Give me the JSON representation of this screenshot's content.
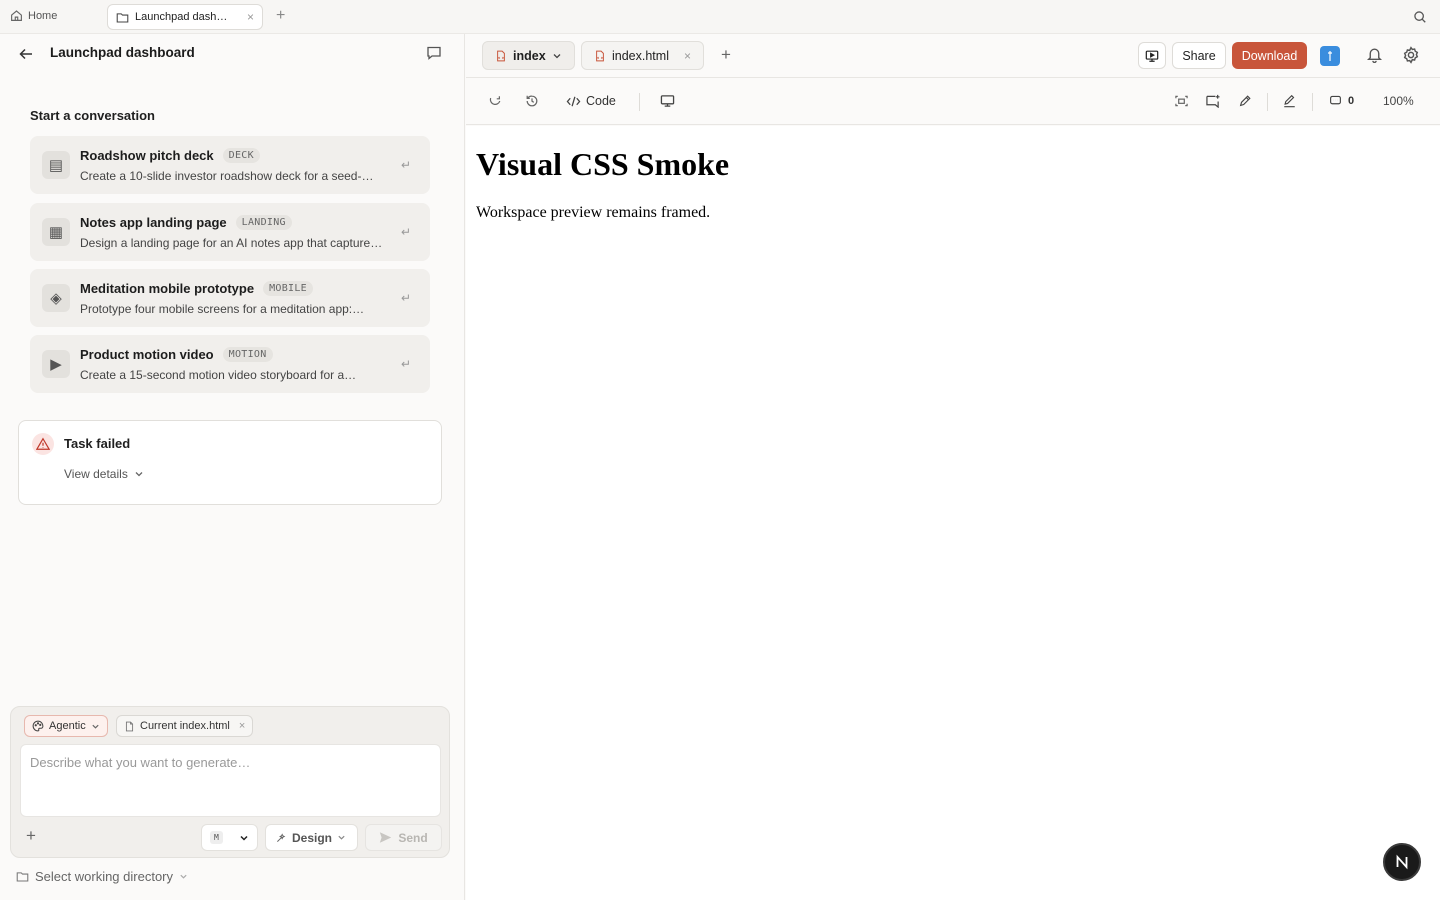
{
  "browser": {
    "home_label": "Home",
    "tab_label": "Launchpad dash…",
    "tab_close": "×",
    "tab_add": "+"
  },
  "sidebar": {
    "title": "Launchpad dashboard",
    "start_heading": "Start a conversation",
    "templates": [
      {
        "icon": "▤",
        "icon_name": "deck-icon",
        "title": "Roadshow pitch deck",
        "badge": "DECK",
        "desc": "Create a 10-slide investor roadshow deck for a seed-…",
        "ret": "↵"
      },
      {
        "icon": "▦",
        "icon_name": "landing-icon",
        "title": "Notes app landing page",
        "badge": "LANDING",
        "desc": "Design a landing page for an AI notes app that capture…",
        "ret": "↵"
      },
      {
        "icon": "◈",
        "icon_name": "mobile-icon",
        "title": "Meditation mobile prototype",
        "badge": "MOBILE",
        "desc": "Prototype four mobile screens for a meditation app:…",
        "ret": "↵"
      },
      {
        "icon": "▶",
        "icon_name": "motion-icon",
        "title": "Product motion video",
        "badge": "MOTION",
        "desc": "Create a 15-second motion video storyboard for a…",
        "ret": "↵"
      }
    ],
    "status": {
      "title": "Task failed",
      "details_label": "View details"
    }
  },
  "composer": {
    "mode_label": "Agentic",
    "context_file": "Current index.html",
    "context_close": "×",
    "placeholder": "Describe what you want to generate…",
    "add": "+",
    "model_badge": "M",
    "design_label": "Design",
    "send_label": "Send",
    "working_dir_label": "Select working directory"
  },
  "workspace": {
    "page_tab": "index",
    "file_tab": "index.html",
    "file_close": "×",
    "add": "+",
    "share_label": "Share",
    "download_label": "Download",
    "code_label": "Code",
    "comment_count": "0",
    "zoom": "100%",
    "preview": {
      "heading": "Visual CSS Smoke",
      "paragraph": "Workspace preview remains framed."
    }
  },
  "colors": {
    "accent": "#c8553a",
    "avatar": "#3a8dde",
    "danger": "#c0392b"
  }
}
